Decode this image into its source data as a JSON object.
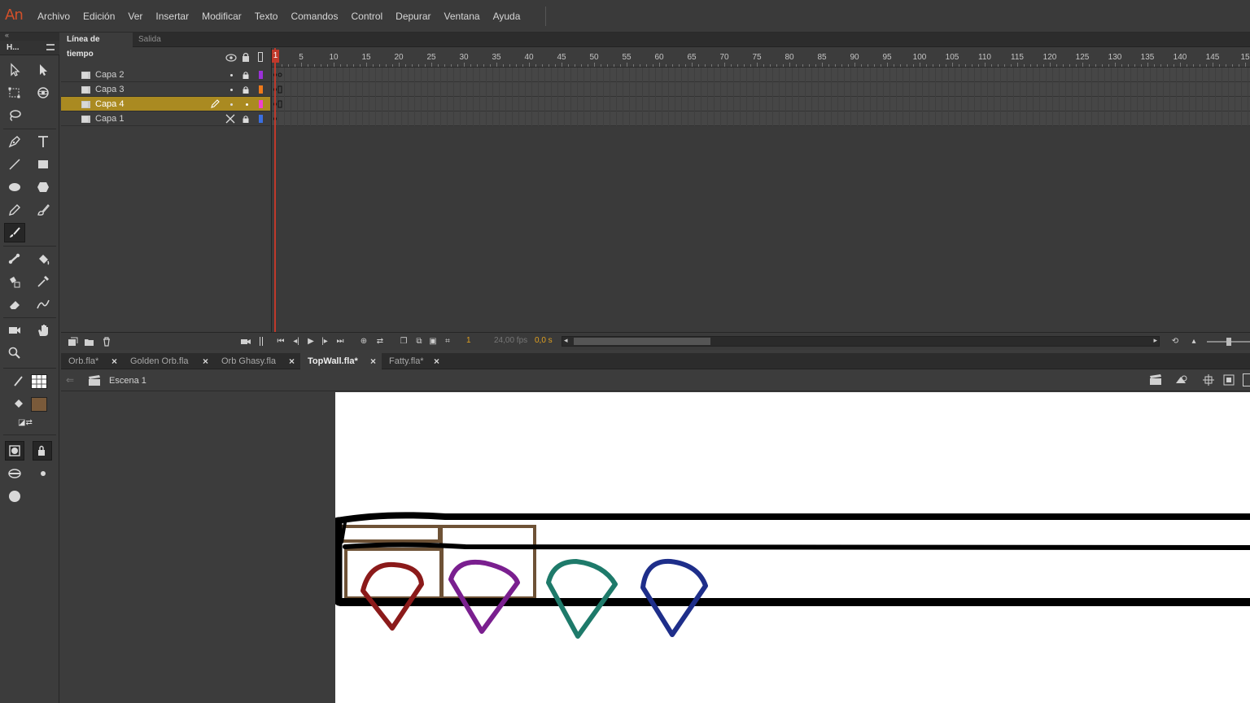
{
  "app": {
    "logo": "An"
  },
  "menu": [
    "Archivo",
    "Edición",
    "Ver",
    "Insertar",
    "Modificar",
    "Texto",
    "Comandos",
    "Control",
    "Depurar",
    "Ventana",
    "Ayuda"
  ],
  "tools_panel": {
    "title": "H..."
  },
  "timeline": {
    "tabs": [
      "Línea de tiempo",
      "Salida"
    ],
    "active_tab": 0,
    "ruler_labels": [
      "1",
      "5",
      "10",
      "15",
      "20",
      "25",
      "30",
      "35",
      "40",
      "45",
      "50",
      "55",
      "60",
      "65",
      "70",
      "75",
      "80",
      "85",
      "90",
      "95",
      "100",
      "105",
      "110",
      "115",
      "120",
      "125",
      "130",
      "135",
      "140",
      "145",
      "15"
    ],
    "layers": [
      {
        "name": "Capa 2",
        "color": "#9b30d9",
        "selected": false,
        "visibility": "dot"
      },
      {
        "name": "Capa 3",
        "color": "#f07a1a",
        "selected": false,
        "visibility": "dot"
      },
      {
        "name": "Capa 4",
        "color": "#f040d0",
        "selected": true,
        "visibility": "dot"
      },
      {
        "name": "Capa 1",
        "color": "#3a6ee0",
        "selected": false,
        "visibility": "hidden-x"
      }
    ],
    "current_frame": "1",
    "frame_rate": "24,00 fps",
    "elapsed": "0,0 s"
  },
  "documents": [
    {
      "name": "Orb.fla*",
      "active": false
    },
    {
      "name": "Golden Orb.fla",
      "active": false
    },
    {
      "name": "Orb Ghasy.fla",
      "active": false
    },
    {
      "name": "TopWall.fla*",
      "active": true
    },
    {
      "name": "Fatty.fla*",
      "active": false
    }
  ],
  "scene": {
    "label": "Escena 1"
  },
  "colors": {
    "stroke_swatch": "#333333",
    "fill_swatch": "#7a5a3a",
    "gem_red": "#8b1a1a",
    "gem_purple": "#7a1f8f",
    "gem_teal": "#1e7a6a",
    "gem_blue": "#1e2e8a",
    "wood": "#6e5236"
  }
}
